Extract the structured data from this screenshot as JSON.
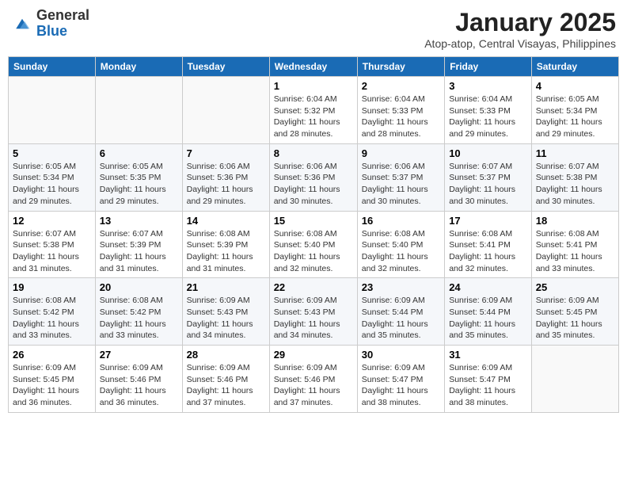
{
  "header": {
    "logo_general": "General",
    "logo_blue": "Blue",
    "month_title": "January 2025",
    "subtitle": "Atop-atop, Central Visayas, Philippines"
  },
  "weekdays": [
    "Sunday",
    "Monday",
    "Tuesday",
    "Wednesday",
    "Thursday",
    "Friday",
    "Saturday"
  ],
  "weeks": [
    [
      {
        "day": "",
        "sunrise": "",
        "sunset": "",
        "daylight": ""
      },
      {
        "day": "",
        "sunrise": "",
        "sunset": "",
        "daylight": ""
      },
      {
        "day": "",
        "sunrise": "",
        "sunset": "",
        "daylight": ""
      },
      {
        "day": "1",
        "sunrise": "Sunrise: 6:04 AM",
        "sunset": "Sunset: 5:32 PM",
        "daylight": "Daylight: 11 hours and 28 minutes."
      },
      {
        "day": "2",
        "sunrise": "Sunrise: 6:04 AM",
        "sunset": "Sunset: 5:33 PM",
        "daylight": "Daylight: 11 hours and 28 minutes."
      },
      {
        "day": "3",
        "sunrise": "Sunrise: 6:04 AM",
        "sunset": "Sunset: 5:33 PM",
        "daylight": "Daylight: 11 hours and 29 minutes."
      },
      {
        "day": "4",
        "sunrise": "Sunrise: 6:05 AM",
        "sunset": "Sunset: 5:34 PM",
        "daylight": "Daylight: 11 hours and 29 minutes."
      }
    ],
    [
      {
        "day": "5",
        "sunrise": "Sunrise: 6:05 AM",
        "sunset": "Sunset: 5:34 PM",
        "daylight": "Daylight: 11 hours and 29 minutes."
      },
      {
        "day": "6",
        "sunrise": "Sunrise: 6:05 AM",
        "sunset": "Sunset: 5:35 PM",
        "daylight": "Daylight: 11 hours and 29 minutes."
      },
      {
        "day": "7",
        "sunrise": "Sunrise: 6:06 AM",
        "sunset": "Sunset: 5:36 PM",
        "daylight": "Daylight: 11 hours and 29 minutes."
      },
      {
        "day": "8",
        "sunrise": "Sunrise: 6:06 AM",
        "sunset": "Sunset: 5:36 PM",
        "daylight": "Daylight: 11 hours and 30 minutes."
      },
      {
        "day": "9",
        "sunrise": "Sunrise: 6:06 AM",
        "sunset": "Sunset: 5:37 PM",
        "daylight": "Daylight: 11 hours and 30 minutes."
      },
      {
        "day": "10",
        "sunrise": "Sunrise: 6:07 AM",
        "sunset": "Sunset: 5:37 PM",
        "daylight": "Daylight: 11 hours and 30 minutes."
      },
      {
        "day": "11",
        "sunrise": "Sunrise: 6:07 AM",
        "sunset": "Sunset: 5:38 PM",
        "daylight": "Daylight: 11 hours and 30 minutes."
      }
    ],
    [
      {
        "day": "12",
        "sunrise": "Sunrise: 6:07 AM",
        "sunset": "Sunset: 5:38 PM",
        "daylight": "Daylight: 11 hours and 31 minutes."
      },
      {
        "day": "13",
        "sunrise": "Sunrise: 6:07 AM",
        "sunset": "Sunset: 5:39 PM",
        "daylight": "Daylight: 11 hours and 31 minutes."
      },
      {
        "day": "14",
        "sunrise": "Sunrise: 6:08 AM",
        "sunset": "Sunset: 5:39 PM",
        "daylight": "Daylight: 11 hours and 31 minutes."
      },
      {
        "day": "15",
        "sunrise": "Sunrise: 6:08 AM",
        "sunset": "Sunset: 5:40 PM",
        "daylight": "Daylight: 11 hours and 32 minutes."
      },
      {
        "day": "16",
        "sunrise": "Sunrise: 6:08 AM",
        "sunset": "Sunset: 5:40 PM",
        "daylight": "Daylight: 11 hours and 32 minutes."
      },
      {
        "day": "17",
        "sunrise": "Sunrise: 6:08 AM",
        "sunset": "Sunset: 5:41 PM",
        "daylight": "Daylight: 11 hours and 32 minutes."
      },
      {
        "day": "18",
        "sunrise": "Sunrise: 6:08 AM",
        "sunset": "Sunset: 5:41 PM",
        "daylight": "Daylight: 11 hours and 33 minutes."
      }
    ],
    [
      {
        "day": "19",
        "sunrise": "Sunrise: 6:08 AM",
        "sunset": "Sunset: 5:42 PM",
        "daylight": "Daylight: 11 hours and 33 minutes."
      },
      {
        "day": "20",
        "sunrise": "Sunrise: 6:08 AM",
        "sunset": "Sunset: 5:42 PM",
        "daylight": "Daylight: 11 hours and 33 minutes."
      },
      {
        "day": "21",
        "sunrise": "Sunrise: 6:09 AM",
        "sunset": "Sunset: 5:43 PM",
        "daylight": "Daylight: 11 hours and 34 minutes."
      },
      {
        "day": "22",
        "sunrise": "Sunrise: 6:09 AM",
        "sunset": "Sunset: 5:43 PM",
        "daylight": "Daylight: 11 hours and 34 minutes."
      },
      {
        "day": "23",
        "sunrise": "Sunrise: 6:09 AM",
        "sunset": "Sunset: 5:44 PM",
        "daylight": "Daylight: 11 hours and 35 minutes."
      },
      {
        "day": "24",
        "sunrise": "Sunrise: 6:09 AM",
        "sunset": "Sunset: 5:44 PM",
        "daylight": "Daylight: 11 hours and 35 minutes."
      },
      {
        "day": "25",
        "sunrise": "Sunrise: 6:09 AM",
        "sunset": "Sunset: 5:45 PM",
        "daylight": "Daylight: 11 hours and 35 minutes."
      }
    ],
    [
      {
        "day": "26",
        "sunrise": "Sunrise: 6:09 AM",
        "sunset": "Sunset: 5:45 PM",
        "daylight": "Daylight: 11 hours and 36 minutes."
      },
      {
        "day": "27",
        "sunrise": "Sunrise: 6:09 AM",
        "sunset": "Sunset: 5:46 PM",
        "daylight": "Daylight: 11 hours and 36 minutes."
      },
      {
        "day": "28",
        "sunrise": "Sunrise: 6:09 AM",
        "sunset": "Sunset: 5:46 PM",
        "daylight": "Daylight: 11 hours and 37 minutes."
      },
      {
        "day": "29",
        "sunrise": "Sunrise: 6:09 AM",
        "sunset": "Sunset: 5:46 PM",
        "daylight": "Daylight: 11 hours and 37 minutes."
      },
      {
        "day": "30",
        "sunrise": "Sunrise: 6:09 AM",
        "sunset": "Sunset: 5:47 PM",
        "daylight": "Daylight: 11 hours and 38 minutes."
      },
      {
        "day": "31",
        "sunrise": "Sunrise: 6:09 AM",
        "sunset": "Sunset: 5:47 PM",
        "daylight": "Daylight: 11 hours and 38 minutes."
      },
      {
        "day": "",
        "sunrise": "",
        "sunset": "",
        "daylight": ""
      }
    ]
  ]
}
